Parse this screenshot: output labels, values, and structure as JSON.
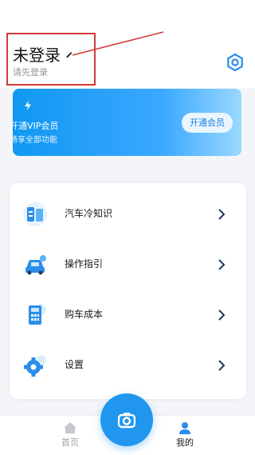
{
  "profile": {
    "login_status": "未登录",
    "login_prompt": "请先登录"
  },
  "vip": {
    "title": "开通VIP会员",
    "description": "畅享全部功能",
    "button_label": "开通会员"
  },
  "menu": {
    "items": [
      {
        "label": "汽车冷知识",
        "icon": "knowledge-icon"
      },
      {
        "label": "操作指引",
        "icon": "car-guide-icon"
      },
      {
        "label": "购车成本",
        "icon": "calculator-icon"
      },
      {
        "label": "设置",
        "icon": "settings-gear-icon"
      }
    ]
  },
  "tabbar": {
    "home_label": "首页",
    "mine_label": "我的",
    "active": "mine"
  },
  "colors": {
    "accent": "#2196ee",
    "annotation": "#d33a3a"
  }
}
